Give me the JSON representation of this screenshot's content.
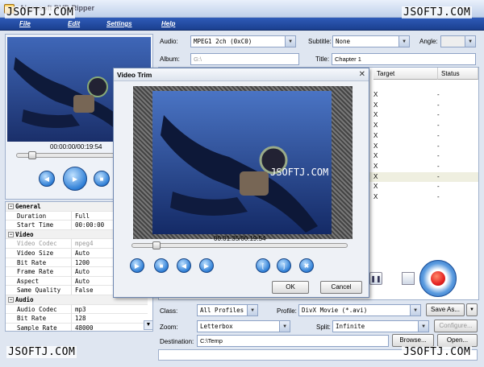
{
  "window": {
    "title": "Aiseesoft DVD Ripper"
  },
  "watermark": "JSOFTJ.COM",
  "menu": [
    "File",
    "Edit",
    "Settings",
    "Help"
  ],
  "player": {
    "time": "00:00:00/00:19:54",
    "progress": 0.1
  },
  "properties": [
    {
      "type": "section",
      "label": "General"
    },
    {
      "key": "Duration",
      "value": "Full"
    },
    {
      "key": "Start Time",
      "value": "00:00:00"
    },
    {
      "type": "section",
      "label": "Video"
    },
    {
      "key": "Video Codec",
      "value": "mpeg4",
      "disabled": true
    },
    {
      "key": "Video Size",
      "value": "Auto"
    },
    {
      "key": "Bit Rate",
      "value": "1200"
    },
    {
      "key": "Frame Rate",
      "value": "Auto"
    },
    {
      "key": "Aspect",
      "value": "Auto"
    },
    {
      "key": "Same Quality",
      "value": "False"
    },
    {
      "type": "section",
      "label": "Audio"
    },
    {
      "key": "Audio Codec",
      "value": "mp3"
    },
    {
      "key": "Bit Rate",
      "value": "128"
    },
    {
      "key": "Sample Rate",
      "value": "48000"
    }
  ],
  "top": {
    "audio_label": "Audio:",
    "audio_value": "MPEG1 2ch (0xC0)",
    "subtitle_label": "Subtitle:",
    "subtitle_value": "None",
    "angle_label": "Angle:",
    "angle_value": "",
    "album_label": "Album:",
    "album_value": "G:\\",
    "title_label": "Title:",
    "title_value": "Chapter 1"
  },
  "list": {
    "col_target": "Target",
    "col_status": "Status",
    "rows": [
      {
        "target": "X",
        "status": "-"
      },
      {
        "target": "X",
        "status": "-"
      },
      {
        "target": "X",
        "status": "-"
      },
      {
        "target": "X",
        "status": "-"
      },
      {
        "target": "X",
        "status": "-"
      },
      {
        "target": "X",
        "status": "-"
      },
      {
        "target": "X",
        "status": "-"
      },
      {
        "target": "X",
        "status": "-"
      },
      {
        "target": "X",
        "status": "-",
        "selected": true
      },
      {
        "target": "X",
        "status": "-"
      },
      {
        "target": "X",
        "status": "-"
      }
    ]
  },
  "dialog": {
    "title": "Video Trim",
    "watermark": "JSOFTJ.COM",
    "time": "00:01:35/00:19:54",
    "progress": 0.1,
    "ok": "OK",
    "cancel": "Cancel"
  },
  "bottom": {
    "class_label": "Class:",
    "class_value": "All Profiles",
    "profile_label": "Profile:",
    "profile_value": "DivX Movie  (*.avi)",
    "saveas": "Save As...",
    "zoom_label": "Zoom:",
    "zoom_value": "Letterbox",
    "split_label": "Split:",
    "split_value": "Infinite",
    "configure": "Configure...",
    "dest_label": "Destination:",
    "dest_value": "C:\\Temp",
    "browse": "Browse...",
    "open": "Open..."
  },
  "colors": {
    "menubar": "#1b3f8f",
    "selected_row": "#efefe0",
    "accent": "#2f7fd6",
    "record": "#e52222"
  }
}
